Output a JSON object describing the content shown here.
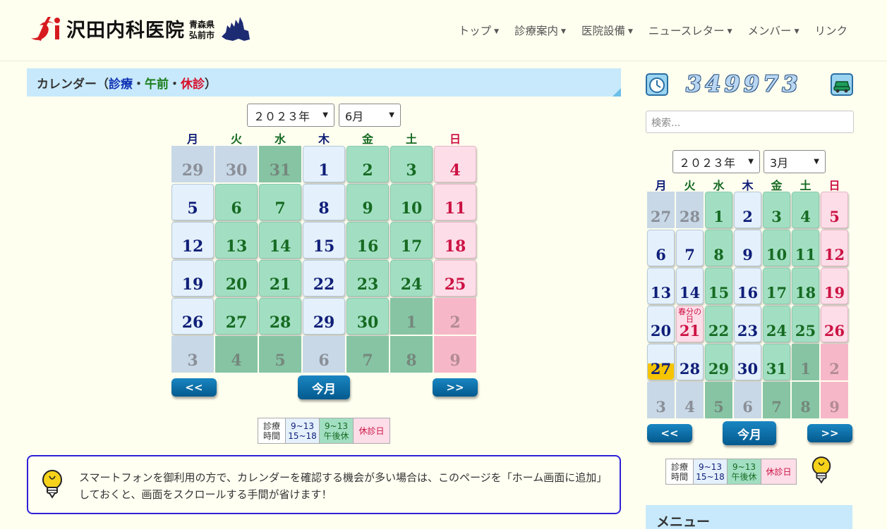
{
  "site": {
    "logo_text": "沢田内科医院",
    "pref_line1": "青森県",
    "pref_line2": "弘前市"
  },
  "nav": [
    {
      "label": "トップ",
      "has_caret": true
    },
    {
      "label": "診療案内",
      "has_caret": true
    },
    {
      "label": "医院設備",
      "has_caret": true
    },
    {
      "label": "ニュースレター",
      "has_caret": true
    },
    {
      "label": "メンバー",
      "has_caret": true
    },
    {
      "label": "リンク",
      "has_caret": false
    }
  ],
  "main": {
    "title_prefix": "カレンダー（",
    "title_shinryo": "診療",
    "title_dot1": "・",
    "title_gozen": "午前",
    "title_dot2": "・",
    "title_kyushin": "休診",
    "title_suffix": "）",
    "year_select": "２０２３年",
    "month_select": "6月",
    "weekdays": [
      "月",
      "火",
      "水",
      "木",
      "金",
      "土",
      "日"
    ],
    "days": [
      {
        "d": "29",
        "t": "gw"
      },
      {
        "d": "30",
        "t": "gw"
      },
      {
        "d": "31",
        "t": "ga"
      },
      {
        "d": "1",
        "t": "wd"
      },
      {
        "d": "2",
        "t": "am"
      },
      {
        "d": "3",
        "t": "am"
      },
      {
        "d": "4",
        "t": "ho"
      },
      {
        "d": "5",
        "t": "wd"
      },
      {
        "d": "6",
        "t": "am"
      },
      {
        "d": "7",
        "t": "am"
      },
      {
        "d": "8",
        "t": "wd"
      },
      {
        "d": "9",
        "t": "am"
      },
      {
        "d": "10",
        "t": "am"
      },
      {
        "d": "11",
        "t": "ho"
      },
      {
        "d": "12",
        "t": "wd"
      },
      {
        "d": "13",
        "t": "am"
      },
      {
        "d": "14",
        "t": "am"
      },
      {
        "d": "15",
        "t": "wd"
      },
      {
        "d": "16",
        "t": "am"
      },
      {
        "d": "17",
        "t": "am"
      },
      {
        "d": "18",
        "t": "ho"
      },
      {
        "d": "19",
        "t": "wd"
      },
      {
        "d": "20",
        "t": "am"
      },
      {
        "d": "21",
        "t": "am"
      },
      {
        "d": "22",
        "t": "wd"
      },
      {
        "d": "23",
        "t": "am"
      },
      {
        "d": "24",
        "t": "am"
      },
      {
        "d": "25",
        "t": "ho"
      },
      {
        "d": "26",
        "t": "wd"
      },
      {
        "d": "27",
        "t": "am"
      },
      {
        "d": "28",
        "t": "am"
      },
      {
        "d": "29",
        "t": "wd"
      },
      {
        "d": "30",
        "t": "am"
      },
      {
        "d": "1",
        "t": "ga"
      },
      {
        "d": "2",
        "t": "gh"
      },
      {
        "d": "3",
        "t": "gw"
      },
      {
        "d": "4",
        "t": "ga"
      },
      {
        "d": "5",
        "t": "ga"
      },
      {
        "d": "6",
        "t": "gw"
      },
      {
        "d": "7",
        "t": "ga"
      },
      {
        "d": "8",
        "t": "ga"
      },
      {
        "d": "9",
        "t": "gh"
      }
    ],
    "prev_label": "<<",
    "today_label": "今月",
    "next_label": ">>",
    "legend": {
      "hours_l1": "診療",
      "hours_l2": "時間",
      "full_l1": "9~13",
      "full_l2": "15~18",
      "am_l1": "9~13",
      "am_l2": "午後休",
      "closed": "休診日"
    },
    "tip_text": "スマートフォンを御利用の方で、カレンダーを確認する機会が多い場合は、このページを「ホーム画面に追加」しておくと、画面をスクロールする手間が省けます！"
  },
  "sidebar": {
    "counter": "349973",
    "search_placeholder": "検索...",
    "year_select": "２０２３年",
    "month_select": "3月",
    "weekdays": [
      "月",
      "火",
      "水",
      "木",
      "金",
      "土",
      "日"
    ],
    "days": [
      {
        "d": "27",
        "t": "gw"
      },
      {
        "d": "28",
        "t": "gw"
      },
      {
        "d": "1",
        "t": "am"
      },
      {
        "d": "2",
        "t": "wd"
      },
      {
        "d": "3",
        "t": "am"
      },
      {
        "d": "4",
        "t": "am"
      },
      {
        "d": "5",
        "t": "ho"
      },
      {
        "d": "6",
        "t": "wd"
      },
      {
        "d": "7",
        "t": "wd"
      },
      {
        "d": "8",
        "t": "am"
      },
      {
        "d": "9",
        "t": "wd"
      },
      {
        "d": "10",
        "t": "am"
      },
      {
        "d": "11",
        "t": "am"
      },
      {
        "d": "12",
        "t": "ho"
      },
      {
        "d": "13",
        "t": "wd"
      },
      {
        "d": "14",
        "t": "wd"
      },
      {
        "d": "15",
        "t": "am"
      },
      {
        "d": "16",
        "t": "wd"
      },
      {
        "d": "17",
        "t": "am"
      },
      {
        "d": "18",
        "t": "am"
      },
      {
        "d": "19",
        "t": "ho"
      },
      {
        "d": "20",
        "t": "wd"
      },
      {
        "d": "21",
        "t": "ho",
        "name": "春分の日"
      },
      {
        "d": "22",
        "t": "am"
      },
      {
        "d": "23",
        "t": "wd"
      },
      {
        "d": "24",
        "t": "am"
      },
      {
        "d": "25",
        "t": "am"
      },
      {
        "d": "26",
        "t": "ho"
      },
      {
        "d": "27",
        "t": "wd",
        "today": true
      },
      {
        "d": "28",
        "t": "wd"
      },
      {
        "d": "29",
        "t": "am"
      },
      {
        "d": "30",
        "t": "wd"
      },
      {
        "d": "31",
        "t": "am"
      },
      {
        "d": "1",
        "t": "ga"
      },
      {
        "d": "2",
        "t": "gh"
      },
      {
        "d": "3",
        "t": "gw"
      },
      {
        "d": "4",
        "t": "gw"
      },
      {
        "d": "5",
        "t": "ga"
      },
      {
        "d": "6",
        "t": "gw"
      },
      {
        "d": "7",
        "t": "ga"
      },
      {
        "d": "8",
        "t": "ga"
      },
      {
        "d": "9",
        "t": "gh"
      }
    ],
    "prev_label": "<<",
    "today_label": "今月",
    "next_label": ">>",
    "legend": {
      "hours_l1": "診療",
      "hours_l2": "時間",
      "full_l1": "9~13",
      "full_l2": "15~18",
      "am_l1": "9~13",
      "am_l2": "午後休",
      "closed": "休診日"
    },
    "menu_title": "メニュー"
  },
  "colors": {
    "page_bg": "#fffff0",
    "accent_blue": "#0f33b4",
    "accent_green": "#1b7d1b",
    "accent_red": "#d70f2b",
    "section_bg": "#c7e9fb"
  }
}
